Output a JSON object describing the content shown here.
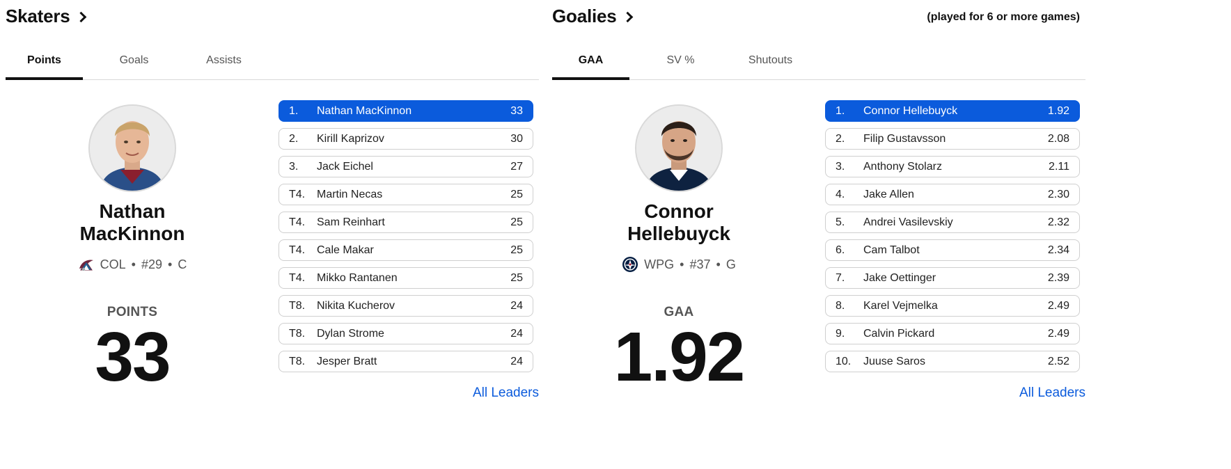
{
  "skaters": {
    "title": "Skaters",
    "tabs": [
      {
        "label": "Points",
        "active": true
      },
      {
        "label": "Goals",
        "active": false
      },
      {
        "label": "Assists",
        "active": false
      }
    ],
    "featured": {
      "name_line1": "Nathan",
      "name_line2": "MacKinnon",
      "team": "COL",
      "number": "#29",
      "position": "C",
      "stat_label": "POINTS",
      "stat_value": "33"
    },
    "leaders": [
      {
        "rank": "1.",
        "name": "Nathan MacKinnon",
        "value": "33"
      },
      {
        "rank": "2.",
        "name": "Kirill Kaprizov",
        "value": "30"
      },
      {
        "rank": "3.",
        "name": "Jack Eichel",
        "value": "27"
      },
      {
        "rank": "T4.",
        "name": "Martin Necas",
        "value": "25"
      },
      {
        "rank": "T4.",
        "name": "Sam Reinhart",
        "value": "25"
      },
      {
        "rank": "T4.",
        "name": "Cale Makar",
        "value": "25"
      },
      {
        "rank": "T4.",
        "name": "Mikko Rantanen",
        "value": "25"
      },
      {
        "rank": "T8.",
        "name": "Nikita Kucherov",
        "value": "24"
      },
      {
        "rank": "T8.",
        "name": "Dylan Strome",
        "value": "24"
      },
      {
        "rank": "T8.",
        "name": "Jesper Bratt",
        "value": "24"
      }
    ],
    "all_leaders": "All Leaders"
  },
  "goalies": {
    "title": "Goalies",
    "qualifier": "(played for 6 or more games)",
    "tabs": [
      {
        "label": "GAA",
        "active": true
      },
      {
        "label": "SV %",
        "active": false
      },
      {
        "label": "Shutouts",
        "active": false
      }
    ],
    "featured": {
      "name_line1": "Connor",
      "name_line2": "Hellebuyck",
      "team": "WPG",
      "number": "#37",
      "position": "G",
      "stat_label": "GAA",
      "stat_value": "1.92"
    },
    "leaders": [
      {
        "rank": "1.",
        "name": "Connor Hellebuyck",
        "value": "1.92"
      },
      {
        "rank": "2.",
        "name": "Filip Gustavsson",
        "value": "2.08"
      },
      {
        "rank": "3.",
        "name": "Anthony Stolarz",
        "value": "2.11"
      },
      {
        "rank": "4.",
        "name": "Jake Allen",
        "value": "2.30"
      },
      {
        "rank": "5.",
        "name": "Andrei Vasilevskiy",
        "value": "2.32"
      },
      {
        "rank": "6.",
        "name": "Cam Talbot",
        "value": "2.34"
      },
      {
        "rank": "7.",
        "name": "Jake Oettinger",
        "value": "2.39"
      },
      {
        "rank": "8.",
        "name": "Karel Vejmelka",
        "value": "2.49"
      },
      {
        "rank": "9.",
        "name": "Calvin Pickard",
        "value": "2.49"
      },
      {
        "rank": "10.",
        "name": "Juuse Saros",
        "value": "2.52"
      }
    ],
    "all_leaders": "All Leaders"
  },
  "colors": {
    "accent": "#0b5bdc",
    "text": "#111111",
    "muted": "#555555",
    "border": "#cfcfcf"
  },
  "icons": {
    "title_chevron": "chevron-right-icon",
    "skater_team_logo": "avalanche-logo-icon",
    "goalie_team_logo": "jets-logo-icon"
  }
}
